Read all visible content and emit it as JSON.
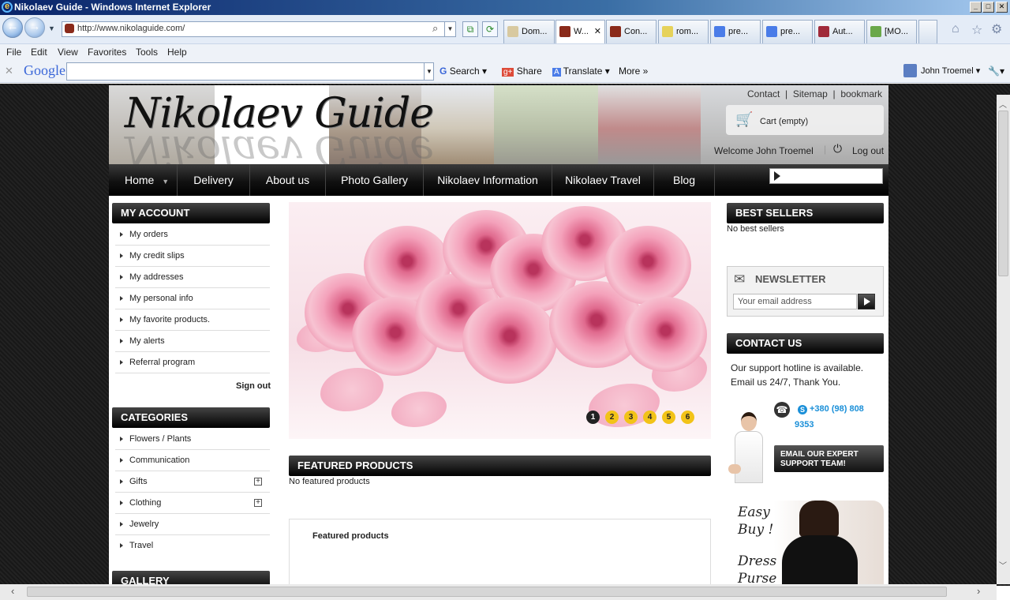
{
  "window": {
    "title": "Nikolaev Guide - Windows Internet Explorer"
  },
  "address": {
    "url": "http://www.nikolaguide.com/"
  },
  "tabs": [
    {
      "label": "Dom..."
    },
    {
      "label": "W..."
    },
    {
      "label": "Con..."
    },
    {
      "label": "rom..."
    },
    {
      "label": "pre..."
    },
    {
      "label": "pre..."
    },
    {
      "label": "Aut..."
    },
    {
      "label": "[MO..."
    }
  ],
  "menu": {
    "file": "File",
    "edit": "Edit",
    "view": "View",
    "favorites": "Favorites",
    "tools": "Tools",
    "help": "Help"
  },
  "google_bar": {
    "logo": "Google",
    "search": "Search",
    "share": "Share",
    "translate": "Translate",
    "more": "More",
    "user": "John Troemel"
  },
  "site": {
    "logo": "Nikolaev Guide",
    "top_links": {
      "contact": "Contact",
      "sitemap": "Sitemap",
      "bookmark": "bookmark"
    },
    "cart": "Cart (empty)",
    "welcome": "Welcome John Troemel",
    "logout": "Log out",
    "nav": [
      "Home",
      "Delivery",
      "About us",
      "Photo Gallery",
      "Nikolaev Information",
      "Nikolaev Travel",
      "Blog"
    ],
    "my_account": {
      "title": "MY ACCOUNT",
      "items": [
        "My orders",
        "My credit slips",
        "My addresses",
        "My personal info",
        "My favorite products.",
        "My alerts",
        "Referral program"
      ],
      "signout": "Sign out"
    },
    "categories": {
      "title": "CATEGORIES",
      "items": [
        "Flowers / Plants",
        "Communication",
        "Gifts",
        "Clothing",
        "Jewelry",
        "Travel"
      ]
    },
    "gallery": {
      "title": "GALLERY"
    },
    "slider": {
      "pages": [
        "1",
        "2",
        "3",
        "4",
        "5",
        "6"
      ]
    },
    "featured": {
      "title": "FEATURED PRODUCTS",
      "empty": "No featured products",
      "box_title": "Featured products"
    },
    "best_sellers": {
      "title": "BEST SELLERS",
      "empty": "No best sellers"
    },
    "newsletter": {
      "title": "NEWSLETTER",
      "placeholder": "Your email address"
    },
    "contact": {
      "title": "CONTACT US",
      "line1": "Our support hotline is available.",
      "line2": "Email us 24/7, Thank You.",
      "phone1": "+380 (98) 808",
      "phone2": "9353",
      "expert_line1": "EMAIL OUR EXPERT",
      "expert_line2": "SUPPORT TEAM!"
    },
    "ad": {
      "line1": "Easy",
      "line2": "Buy !",
      "line3": "Dress",
      "line4": "Purse"
    }
  },
  "colors": {
    "accent": "#f2c318",
    "nav": "#111111",
    "link": "#1a8fd8"
  }
}
